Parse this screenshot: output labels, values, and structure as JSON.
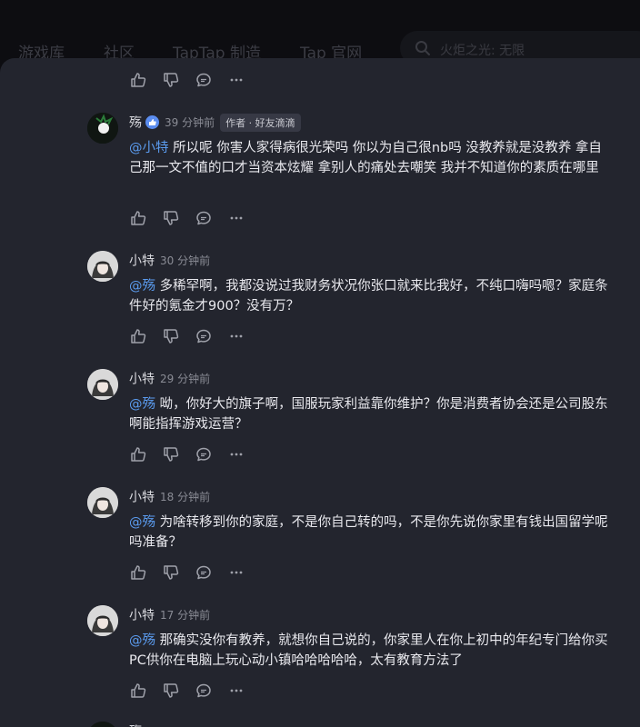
{
  "nav": {
    "items": [
      "游戏库",
      "社区",
      "TapTap 制造",
      "Tap 官网"
    ],
    "search_placeholder": "火炬之光: 无限"
  },
  "comments": [
    {
      "user": "殇",
      "time": "39 分钟前",
      "tag": "作者 · 好友滴滴",
      "mention": "@小特",
      "text": " 所以呢 你害人家得病很光荣吗 你以为自己很nb吗 没教养就是没教养 拿自己那一文不值的口才当资本炫耀 拿别人的痛处去嘲笑 我并不知道你的素质在哪里"
    },
    {
      "user": "小特",
      "time": "30 分钟前",
      "mention": "@殇",
      "text": " 多稀罕啊，我都没说过我财务状况你张口就来比我好，不纯口嗨吗嗯？家庭条件好的氪金才900？没有万？"
    },
    {
      "user": "小特",
      "time": "29 分钟前",
      "mention": "@殇",
      "text": " 呦，你好大的旗子啊，国服玩家利益靠你维护？你是消费者协会还是公司股东啊能指挥游戏运营？"
    },
    {
      "user": "小特",
      "time": "18 分钟前",
      "mention": "@殇",
      "text": " 为啥转移到你的家庭，不是你自己转的吗，不是你先说你家里有钱出国留学呢吗准备？"
    },
    {
      "user": "小特",
      "time": "17 分钟前",
      "mention": "@殇",
      "text": " 那确实没你有教养，就想你自己说的，你家里人在你上初中的年纪专门给你买PC供你在电脑上玩心动小镇哈哈哈哈哈，太有教育方法了"
    }
  ],
  "partial_last": {
    "user": "殇"
  },
  "icons": [
    "like-icon",
    "dislike-icon",
    "reply-icon",
    "more-icon",
    "verified-badge-icon",
    "search-icon"
  ],
  "colors": {
    "mention": "#5b9cf0",
    "panel": "#23252e",
    "badge": "#5b8df0"
  }
}
